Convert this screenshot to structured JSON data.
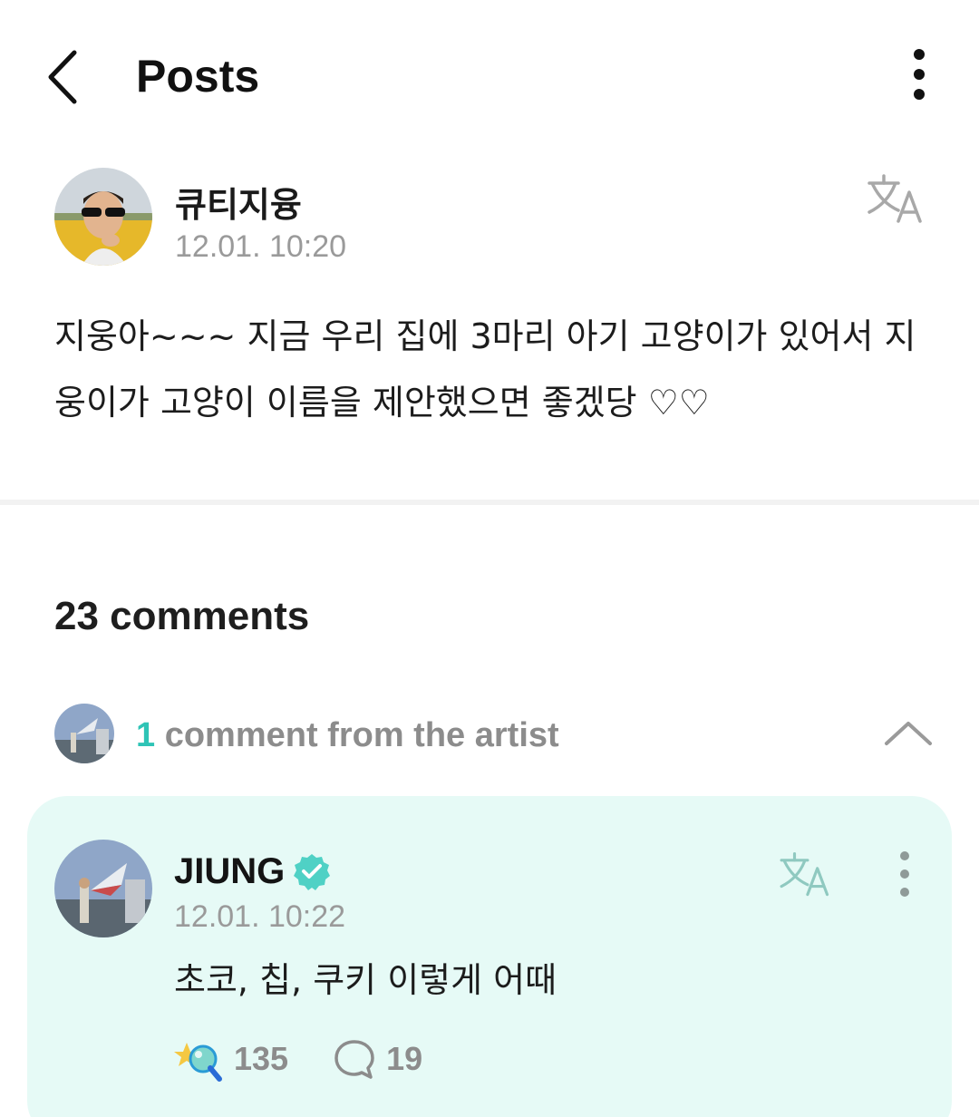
{
  "header": {
    "title": "Posts"
  },
  "post": {
    "author": "큐티지융",
    "time": "12.01. 10:20",
    "body": "지웅아~~~ 지금 우리 집에 3마리 아기 고양이가 있어서 지웅이가 고양이 이름을 제안했으면 좋겠당 ♡♡"
  },
  "comments": {
    "count_label": "23 comments",
    "artist_bar": {
      "count": "1",
      "label": "comment from the artist"
    }
  },
  "artist_comment": {
    "name": "JIUNG",
    "time": "12.01. 10:22",
    "text": "초코, 칩, 쿠키 이렇게 어때",
    "likes": "135",
    "replies": "19"
  },
  "colors": {
    "accent": "#2ec4b6",
    "card_bg": "#e6faf6",
    "muted": "#9a9a9a"
  },
  "icons": [
    "back-arrow-icon",
    "more-vertical-icon",
    "translate-icon",
    "verified-badge-icon",
    "chevron-up-icon",
    "like-icon",
    "reply-bubble-icon"
  ]
}
